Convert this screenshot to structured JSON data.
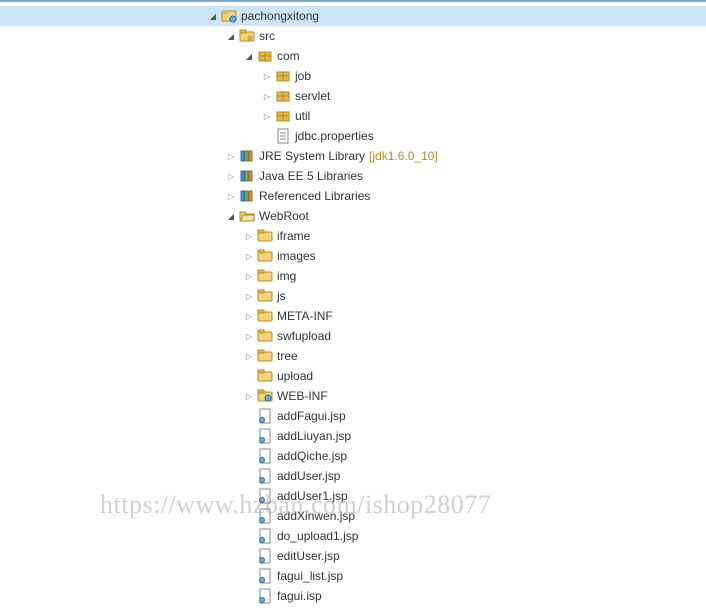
{
  "watermark": "https://www.hzban.com/ishop28077",
  "tree": [
    {
      "indent": 0,
      "toggle": "expanded",
      "icon": "project",
      "label": "pachongxitong",
      "selected": true,
      "interactable": true
    },
    {
      "indent": 1,
      "toggle": "expanded",
      "icon": "src-folder",
      "label": "src",
      "interactable": true
    },
    {
      "indent": 2,
      "toggle": "expanded",
      "icon": "package",
      "label": "com",
      "interactable": true
    },
    {
      "indent": 3,
      "toggle": "collapsed",
      "icon": "package",
      "label": "job",
      "interactable": true
    },
    {
      "indent": 3,
      "toggle": "collapsed",
      "icon": "package",
      "label": "servlet",
      "interactable": true
    },
    {
      "indent": 3,
      "toggle": "collapsed",
      "icon": "package",
      "label": "util",
      "interactable": true
    },
    {
      "indent": 3,
      "toggle": "blank",
      "icon": "file-properties",
      "label": "jdbc.properties",
      "interactable": true
    },
    {
      "indent": 1,
      "toggle": "collapsed",
      "icon": "library",
      "label": "JRE System Library",
      "decorator": "[jdk1.6.0_10]",
      "interactable": true
    },
    {
      "indent": 1,
      "toggle": "collapsed",
      "icon": "library",
      "label": "Java EE 5 Libraries",
      "interactable": true
    },
    {
      "indent": 1,
      "toggle": "collapsed",
      "icon": "library",
      "label": "Referenced Libraries",
      "interactable": true
    },
    {
      "indent": 1,
      "toggle": "expanded",
      "icon": "folder-open",
      "label": "WebRoot",
      "interactable": true
    },
    {
      "indent": 2,
      "toggle": "collapsed",
      "icon": "folder",
      "label": "iframe",
      "interactable": true
    },
    {
      "indent": 2,
      "toggle": "collapsed",
      "icon": "folder",
      "label": "images",
      "interactable": true
    },
    {
      "indent": 2,
      "toggle": "collapsed",
      "icon": "folder",
      "label": "img",
      "interactable": true
    },
    {
      "indent": 2,
      "toggle": "collapsed",
      "icon": "folder",
      "label": "js",
      "interactable": true
    },
    {
      "indent": 2,
      "toggle": "collapsed",
      "icon": "folder",
      "label": "META-INF",
      "interactable": true
    },
    {
      "indent": 2,
      "toggle": "collapsed",
      "icon": "folder",
      "label": "swfupload",
      "interactable": true
    },
    {
      "indent": 2,
      "toggle": "collapsed",
      "icon": "folder",
      "label": "tree",
      "interactable": true
    },
    {
      "indent": 2,
      "toggle": "blank",
      "icon": "folder",
      "label": "upload",
      "interactable": true
    },
    {
      "indent": 2,
      "toggle": "collapsed",
      "icon": "folder-web",
      "label": "WEB-INF",
      "interactable": true
    },
    {
      "indent": 2,
      "toggle": "blank",
      "icon": "jsp",
      "label": "addFagui.jsp",
      "interactable": true
    },
    {
      "indent": 2,
      "toggle": "blank",
      "icon": "jsp",
      "label": "addLiuyan.jsp",
      "interactable": true
    },
    {
      "indent": 2,
      "toggle": "blank",
      "icon": "jsp",
      "label": "addQiche.jsp",
      "interactable": true
    },
    {
      "indent": 2,
      "toggle": "blank",
      "icon": "jsp",
      "label": "addUser.jsp",
      "interactable": true
    },
    {
      "indent": 2,
      "toggle": "blank",
      "icon": "jsp",
      "label": "addUser1.jsp",
      "interactable": true
    },
    {
      "indent": 2,
      "toggle": "blank",
      "icon": "jsp",
      "label": "addXinwen.jsp",
      "interactable": true
    },
    {
      "indent": 2,
      "toggle": "blank",
      "icon": "jsp",
      "label": "do_upload1.jsp",
      "interactable": true
    },
    {
      "indent": 2,
      "toggle": "blank",
      "icon": "jsp",
      "label": "editUser.jsp",
      "interactable": true
    },
    {
      "indent": 2,
      "toggle": "blank",
      "icon": "jsp",
      "label": "fagui_list.jsp",
      "interactable": true
    },
    {
      "indent": 2,
      "toggle": "blank",
      "icon": "jsp",
      "label": "fagui.isp",
      "interactable": true
    }
  ]
}
